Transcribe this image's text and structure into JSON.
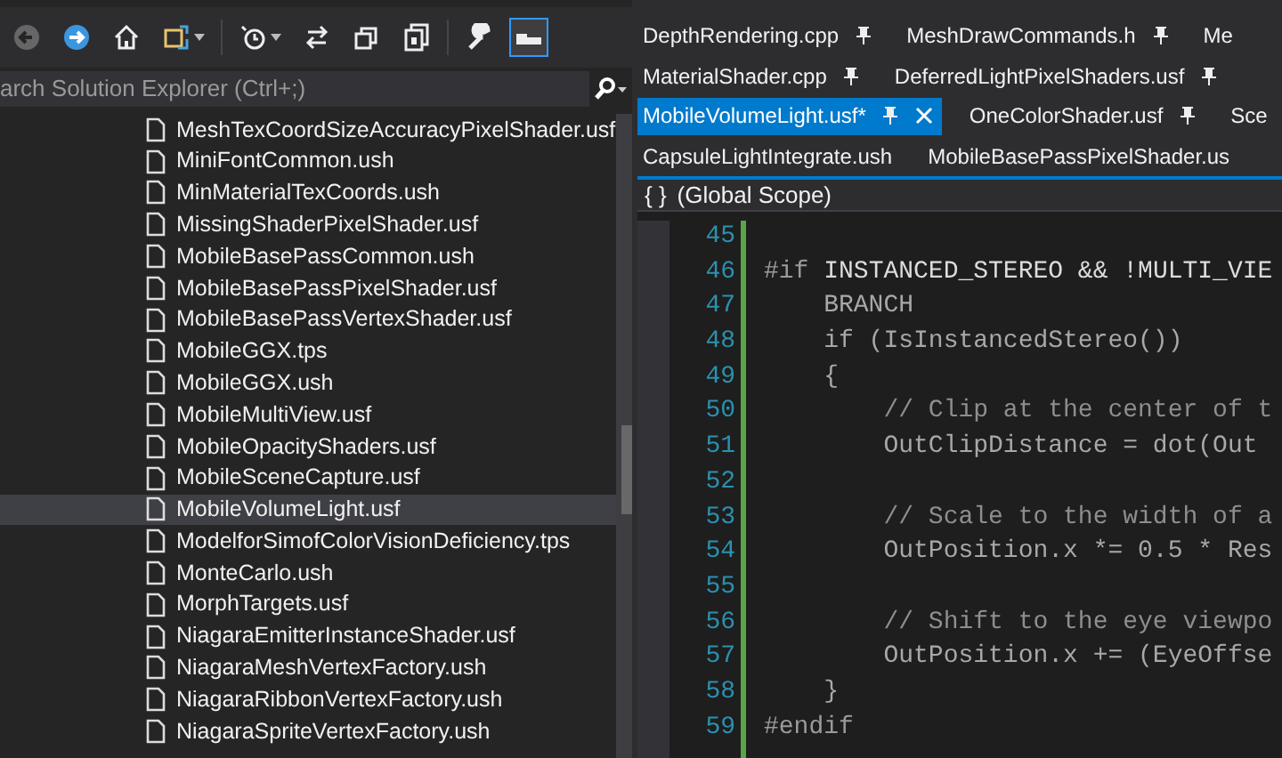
{
  "solution_explorer": {
    "toolbar": [
      {
        "kind": "back"
      },
      {
        "kind": "forward"
      },
      {
        "kind": "home"
      },
      {
        "kind": "sync",
        "dropdown": true
      },
      {
        "kind": "separator"
      },
      {
        "kind": "history",
        "dropdown": true
      },
      {
        "kind": "arrows"
      },
      {
        "kind": "collapse"
      },
      {
        "kind": "files"
      },
      {
        "kind": "separator"
      },
      {
        "kind": "wrench"
      },
      {
        "kind": "preview",
        "selected": true
      }
    ],
    "search": {
      "placeholder": "arch Solution Explorer (Ctrl+;)"
    },
    "items": [
      {
        "label": "MeshTexCoordSizeAccuracyPixelShader.usf",
        "selected": false
      },
      {
        "label": "MiniFontCommon.ush",
        "selected": false
      },
      {
        "label": "MinMaterialTexCoords.ush",
        "selected": false
      },
      {
        "label": "MissingShaderPixelShader.usf",
        "selected": false
      },
      {
        "label": "MobileBasePassCommon.ush",
        "selected": false
      },
      {
        "label": "MobileBasePassPixelShader.usf",
        "selected": false
      },
      {
        "label": "MobileBasePassVertexShader.usf",
        "selected": false
      },
      {
        "label": "MobileGGX.tps",
        "selected": false
      },
      {
        "label": "MobileGGX.ush",
        "selected": false
      },
      {
        "label": "MobileMultiView.usf",
        "selected": false
      },
      {
        "label": "MobileOpacityShaders.usf",
        "selected": false
      },
      {
        "label": "MobileSceneCapture.usf",
        "selected": false
      },
      {
        "label": "MobileVolumeLight.usf",
        "selected": true
      },
      {
        "label": "ModelforSimofColorVisionDeficiency.tps",
        "selected": false
      },
      {
        "label": "MonteCarlo.ush",
        "selected": false
      },
      {
        "label": "MorphTargets.usf",
        "selected": false
      },
      {
        "label": "NiagaraEmitterInstanceShader.usf",
        "selected": false
      },
      {
        "label": "NiagaraMeshVertexFactory.ush",
        "selected": false
      },
      {
        "label": "NiagaraRibbonVertexFactory.ush",
        "selected": false
      },
      {
        "label": "NiagaraSpriteVertexFactory.ush",
        "selected": false
      }
    ]
  },
  "editor": {
    "tab_rows": [
      [
        {
          "label": "DepthRendering.cpp",
          "pinned": true,
          "selected": false
        },
        {
          "label": "MeshDrawCommands.h",
          "pinned": true,
          "selected": false
        },
        {
          "label": "Me",
          "pinned": false,
          "selected": false
        }
      ],
      [
        {
          "label": "MaterialShader.cpp",
          "pinned": true,
          "selected": false
        },
        {
          "label": "DeferredLightPixelShaders.usf",
          "pinned": true,
          "selected": false
        }
      ],
      [
        {
          "label": "MobileVolumeLight.usf*",
          "pinned": true,
          "selected": true
        },
        {
          "label": "OneColorShader.usf",
          "pinned": true,
          "selected": false
        },
        {
          "label": "Sce",
          "pinned": false,
          "selected": false
        }
      ],
      [
        {
          "label": "CapsuleLightIntegrate.ush",
          "pinned": false,
          "selected": false
        },
        {
          "label": "MobileBasePassPixelShader.us",
          "pinned": false,
          "selected": false
        }
      ]
    ],
    "scope": {
      "icon": "{ }",
      "label": "(Global Scope)"
    },
    "lines": [
      {
        "number": "45"
      },
      {
        "number": "46",
        "segments": [
          {
            "kind": "directive",
            "text": "#if "
          },
          {
            "kind": "macro",
            "text": "INSTANCED_STEREO && !MULTI_VIE"
          }
        ]
      },
      {
        "number": "47",
        "segments": [
          {
            "kind": "code",
            "text": "    BRANCH"
          }
        ]
      },
      {
        "number": "48",
        "segments": [
          {
            "kind": "code",
            "text": "    if (IsInstancedStereo())"
          }
        ]
      },
      {
        "number": "49",
        "segments": [
          {
            "kind": "code",
            "text": "    {"
          }
        ]
      },
      {
        "number": "50",
        "segments": [
          {
            "kind": "comment",
            "text": "        // Clip at the center of t"
          }
        ]
      },
      {
        "number": "51",
        "segments": [
          {
            "kind": "code",
            "text": "        OutClipDistance = dot(Out"
          }
        ]
      },
      {
        "number": "52"
      },
      {
        "number": "53",
        "segments": [
          {
            "kind": "comment",
            "text": "        // Scale to the width of a"
          }
        ]
      },
      {
        "number": "54",
        "segments": [
          {
            "kind": "code",
            "text": "        OutPosition.x *= 0.5 * Res"
          }
        ]
      },
      {
        "number": "55"
      },
      {
        "number": "56",
        "segments": [
          {
            "kind": "comment",
            "text": "        // Shift to the eye viewpo"
          }
        ]
      },
      {
        "number": "57",
        "segments": [
          {
            "kind": "code",
            "text": "        OutPosition.x += (EyeOffse"
          }
        ]
      },
      {
        "number": "58",
        "segments": [
          {
            "kind": "code",
            "text": "    }"
          }
        ]
      },
      {
        "number": "59",
        "segments": [
          {
            "kind": "directive",
            "text": "#endif"
          }
        ]
      }
    ]
  }
}
